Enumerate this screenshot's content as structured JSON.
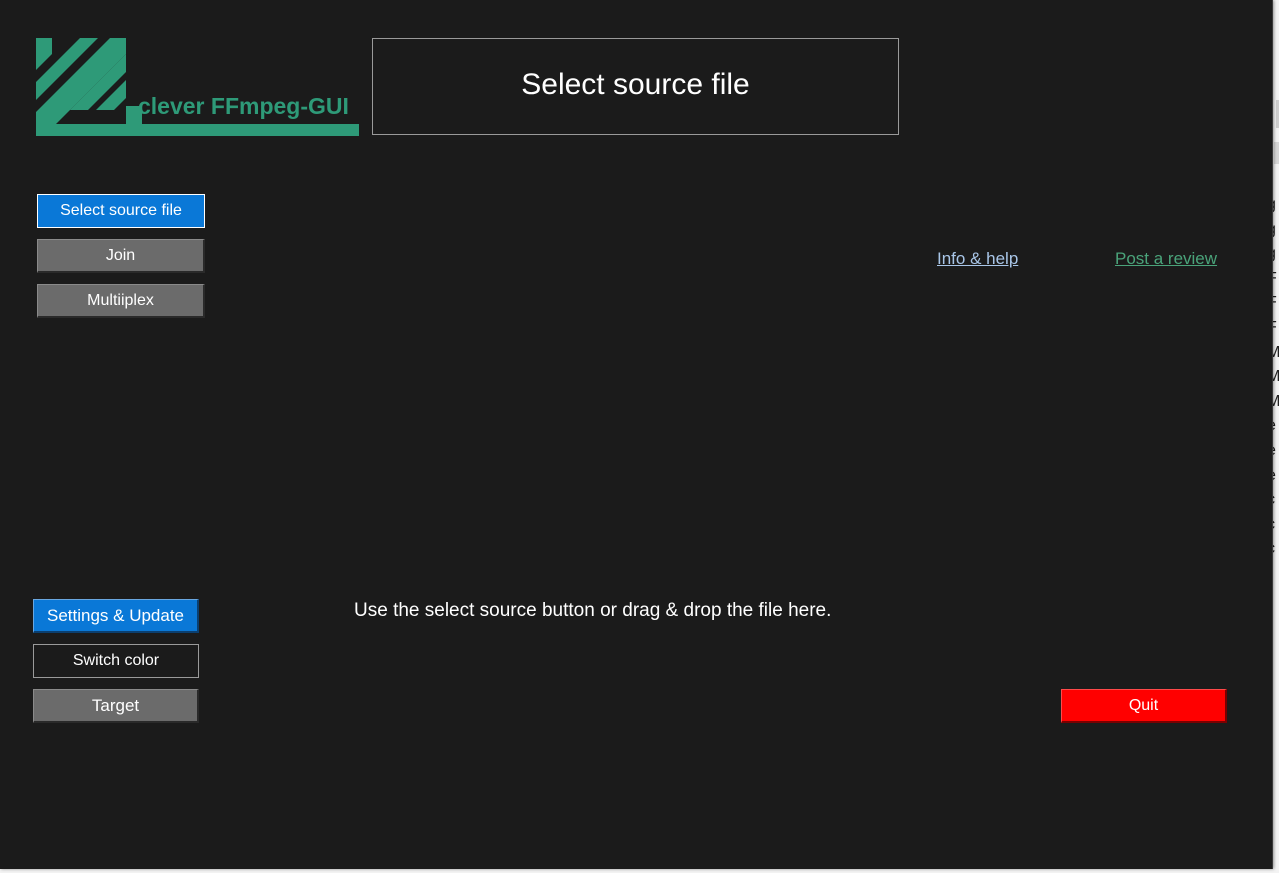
{
  "app": {
    "logo_text": "clever FFmpeg-GUI",
    "title": "Select source file"
  },
  "nav": {
    "select_source": "Select source file",
    "join": "Join",
    "multiplex": "Multiiplex"
  },
  "links": {
    "info_help": "Info & help",
    "post_review": "Post a review"
  },
  "main": {
    "drop_hint": "Use the select source button or drag & drop the file here."
  },
  "bottom": {
    "settings": "Settings & Update",
    "switch_color": "Switch color",
    "target": "Target",
    "quit": "Quit"
  },
  "background_window": {
    "edge_chars": [
      "g",
      "g",
      "g",
      "F",
      "F",
      "F",
      "M",
      "M",
      "M",
      "e",
      "e",
      "e",
      "c",
      "c",
      "c"
    ]
  },
  "colors": {
    "window_bg": "#1b1b1b",
    "accent_blue": "#0a78d7",
    "logo_green": "#2e9a78",
    "quit_red": "#ff0000",
    "button_gray": "#6b6b6b"
  }
}
